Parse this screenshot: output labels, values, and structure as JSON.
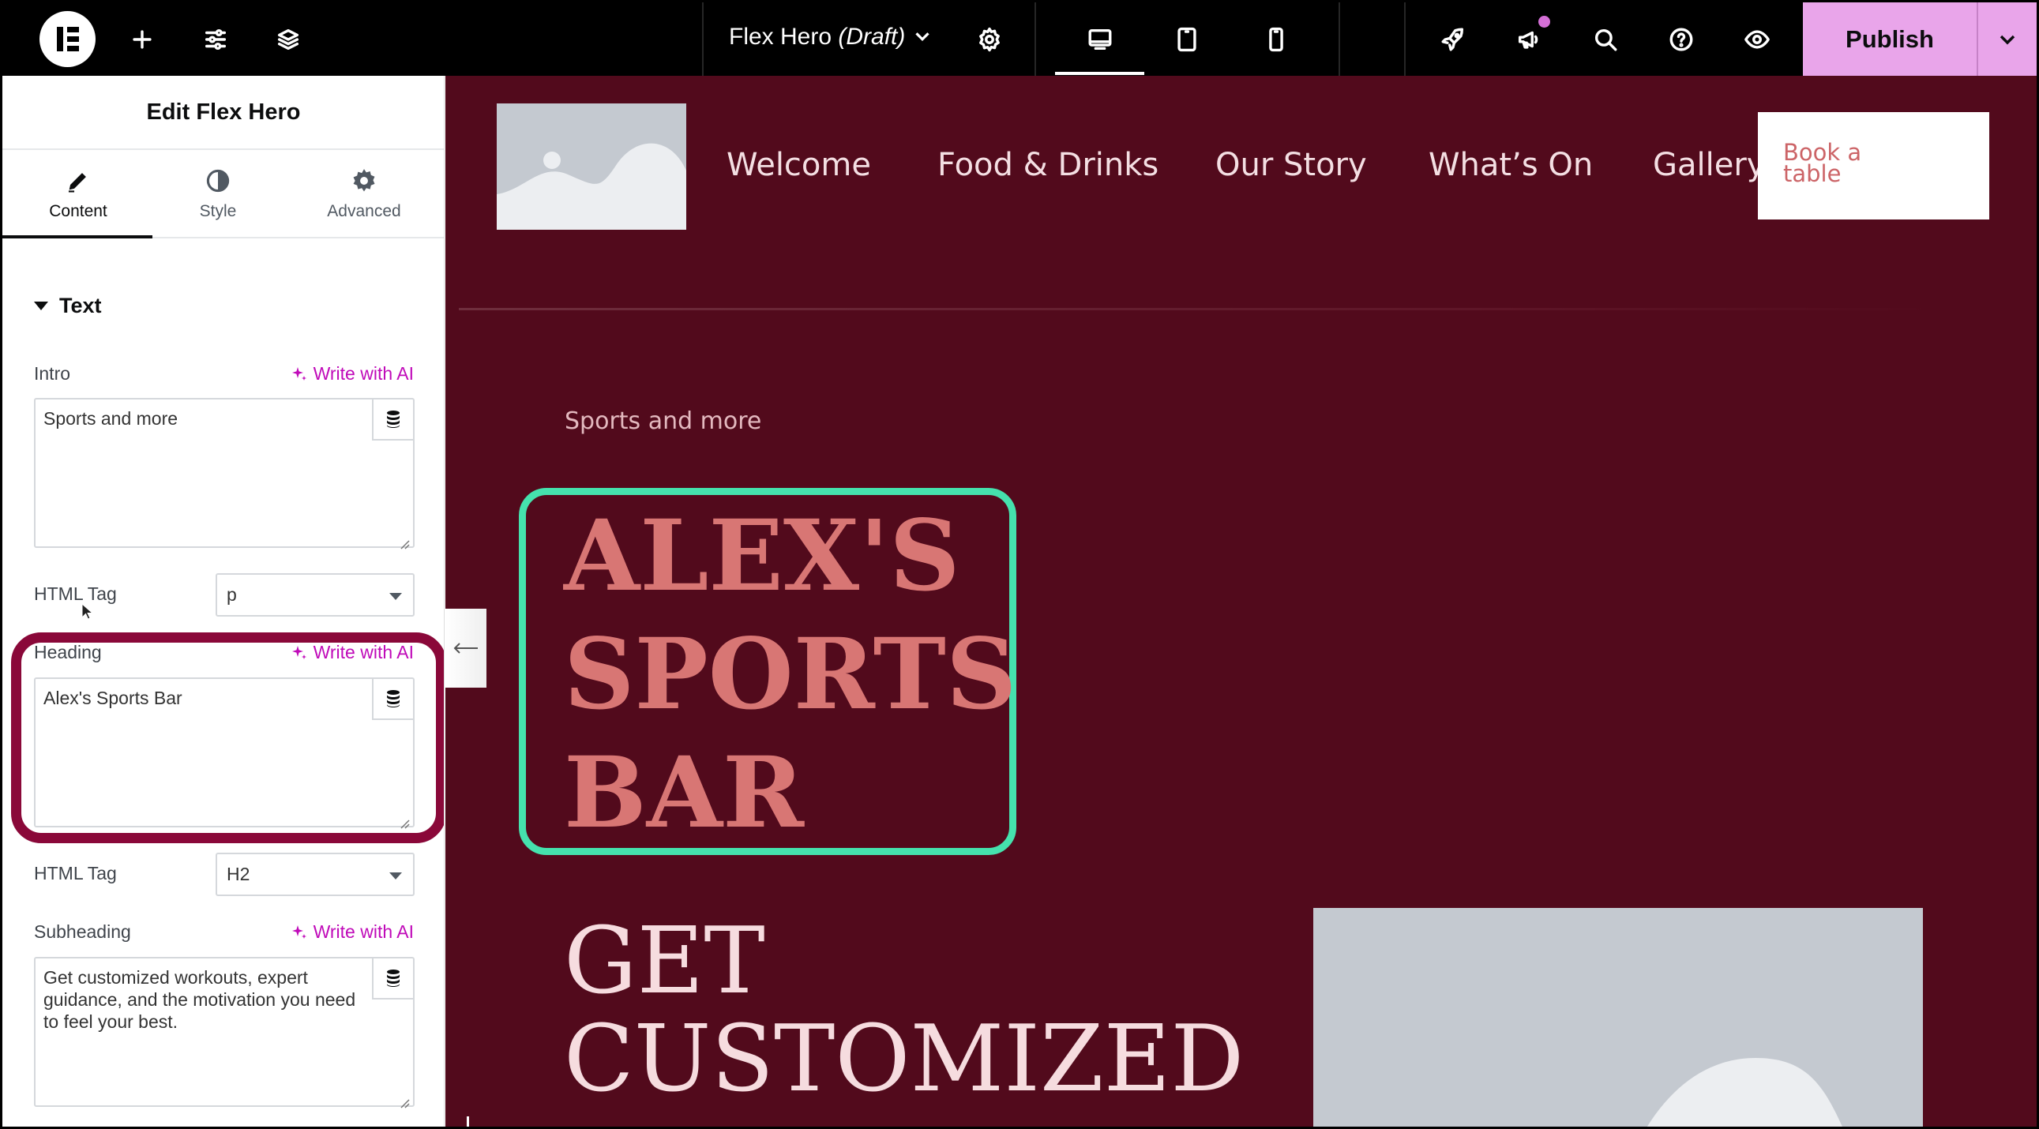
{
  "topbar": {
    "logo": "elementor-logo",
    "add_icon": "plus-icon",
    "settings_icon": "sliders-icon",
    "structure_icon": "layers-icon",
    "doc_title": "Flex Hero",
    "doc_status": "(Draft)",
    "page_settings_icon": "gear-icon",
    "devices": [
      "desktop-icon",
      "tablet-icon",
      "mobile-icon"
    ],
    "active_device": "desktop",
    "right_icons": [
      "rocket-icon",
      "megaphone-icon",
      "search-icon",
      "help-icon",
      "eye-icon"
    ],
    "publish_label": "Publish",
    "publish_menu_icon": "chevron-down-icon",
    "colors": {
      "bar_bg": "#000000",
      "publish_bg": "#e9a5ea",
      "notification_dot": "#d46fd6"
    }
  },
  "panel": {
    "title": "Edit Flex Hero",
    "tabs": [
      {
        "label": "Content",
        "icon": "pencil-icon",
        "active": true
      },
      {
        "label": "Style",
        "icon": "contrast-icon",
        "active": false
      },
      {
        "label": "Advanced",
        "icon": "gear-icon",
        "active": false
      }
    ],
    "section_title": "Text",
    "write_ai": "Write with AI",
    "fields": {
      "intro": {
        "label": "Intro",
        "value": "Sports and more"
      },
      "intro_tag": {
        "label": "HTML Tag",
        "value": "p"
      },
      "heading": {
        "label": "Heading",
        "value": "Alex's Sports Bar"
      },
      "heading_tag": {
        "label": "HTML Tag",
        "value": "H2"
      },
      "subheading": {
        "label": "Subheading",
        "value": "Get customized workouts, expert guidance, and the motivation you need to feel your best."
      }
    },
    "colors": {
      "ai_link": "#c00bb9",
      "highlight": "#8a0839"
    }
  },
  "canvas": {
    "nav": [
      "Welcome",
      "Food & Drinks",
      "Our Story",
      "What’s On",
      "Gallery"
    ],
    "book_button": "Book a table",
    "intro": "Sports and more",
    "hero_heading": "ALEX'S SPORTS BAR",
    "sub_heading": "GET CUSTOMIZED",
    "colors": {
      "background": "#520a1c",
      "heading": "#d87674",
      "selection": "#45e2ad",
      "nav_text": "#f4dfe3"
    }
  }
}
